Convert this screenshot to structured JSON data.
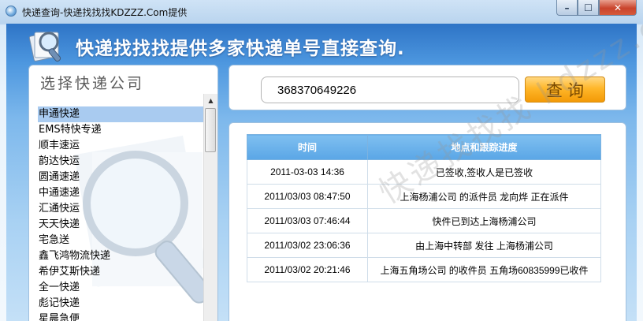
{
  "window": {
    "title": "快递查询-快递找找找KDZZZ.Com提供",
    "min_glyph": "–",
    "max_glyph": "☐",
    "close_glyph": "✕"
  },
  "header": {
    "heading": "快递找找找提供多家快递单号直接查询."
  },
  "sidebar": {
    "title": "选择快递公司",
    "items": [
      {
        "label": "申通快递",
        "selected": true
      },
      {
        "label": "EMS特快专递"
      },
      {
        "label": "顺丰速运"
      },
      {
        "label": "韵达快运"
      },
      {
        "label": "圆通速递"
      },
      {
        "label": "中通速递"
      },
      {
        "label": "汇通快运"
      },
      {
        "label": "天天快递"
      },
      {
        "label": "宅急送"
      },
      {
        "label": "鑫飞鸿物流快递"
      },
      {
        "label": "希伊艾斯快递"
      },
      {
        "label": "全一快递"
      },
      {
        "label": "彪记快递"
      },
      {
        "label": "星晨急便"
      }
    ]
  },
  "search": {
    "value": "368370649226",
    "button_label": "查询"
  },
  "results": {
    "headers": [
      "时间",
      "地点和跟踪进度"
    ],
    "rows": [
      [
        "2011-03-03 14:36",
        "已签收,签收人是已签收"
      ],
      [
        "2011/03/03 08:47:50",
        "上海杨浦公司 的派件员 龙向烨 正在派件"
      ],
      [
        "2011/03/03 07:46:44",
        "快件已到达上海杨浦公司"
      ],
      [
        "2011/03/02 23:06:36",
        "由上海中转部 发往 上海杨浦公司"
      ],
      [
        "2011/03/02 20:21:46",
        "上海五角场公司 的收件员 五角场60835999已收件"
      ]
    ]
  },
  "watermark": {
    "text": "快递找找找 kdzzz.com"
  },
  "icons": {
    "title_icon": "magnifier-icon",
    "logo_icon": "search-logo-icon"
  },
  "colors": {
    "header_blue": "#2e74c6",
    "button_orange": "#ffb72a",
    "table_header": "#5aa6e6",
    "selected_row": "#a9cbf0"
  }
}
